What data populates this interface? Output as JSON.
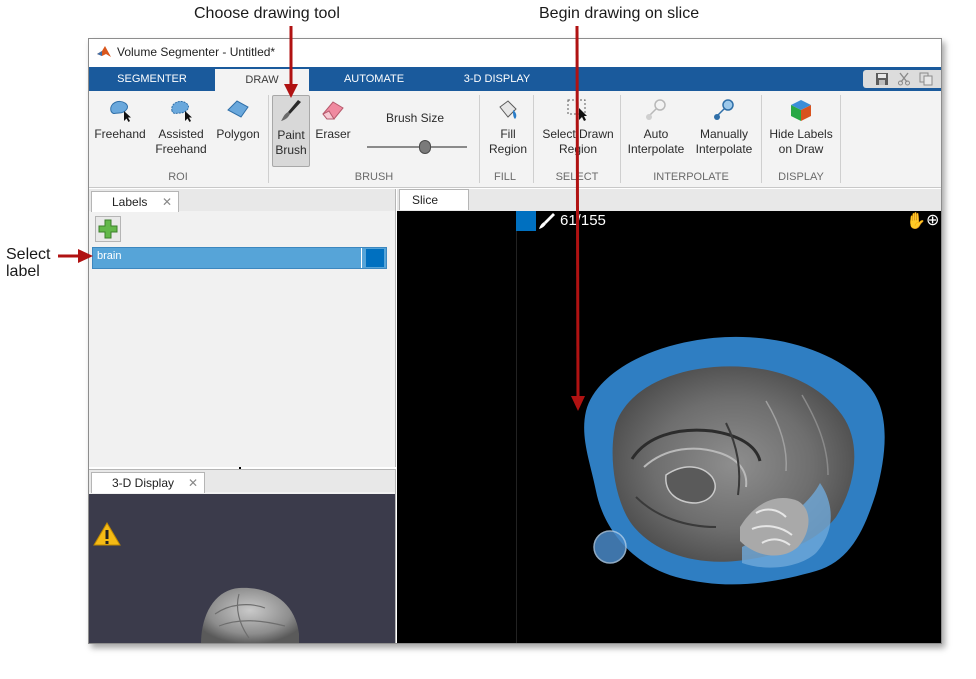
{
  "callouts": {
    "tool": "Choose drawing tool",
    "slice": "Begin drawing on slice",
    "label_line1": "Select",
    "label_line2": "label"
  },
  "window": {
    "title": "Volume Segmenter - Untitled*"
  },
  "tabs": [
    {
      "label": "SEGMENTER",
      "active": false
    },
    {
      "label": "DRAW",
      "active": true
    },
    {
      "label": "AUTOMATE",
      "active": false
    },
    {
      "label": "3-D DISPLAY",
      "active": false
    }
  ],
  "toolstrip": {
    "roi": {
      "section": "ROI",
      "freehand": "Freehand",
      "assisted_1": "Assisted",
      "assisted_2": "Freehand",
      "polygon": "Polygon"
    },
    "brush": {
      "section": "BRUSH",
      "paint_1": "Paint",
      "paint_2": "Brush",
      "eraser": "Eraser",
      "brush_size": "Brush Size",
      "brush_size_value": 0.58
    },
    "fill": {
      "section": "FILL",
      "label_1": "Fill",
      "label_2": "Region"
    },
    "select": {
      "section": "SELECT",
      "label_1": "Select Drawn",
      "label_2": "Region"
    },
    "interpolate": {
      "section": "INTERPOLATE",
      "auto_1": "Auto",
      "auto_2": "Interpolate",
      "manual_1": "Manually",
      "manual_2": "Interpolate"
    },
    "display": {
      "section": "DISPLAY",
      "label_1": "Hide Labels",
      "label_2": "on Draw"
    }
  },
  "panels": {
    "labels_tab": "Labels",
    "display_tab": "3-D Display",
    "slice_tab": "Slice"
  },
  "labels": [
    {
      "name": "brain",
      "color": "#0070c0"
    }
  ],
  "slice": {
    "number": "61/155"
  },
  "colors": {
    "tab_bar": "#1a5a9c",
    "label_color": "#0070c0",
    "arrow": "#b01212"
  }
}
